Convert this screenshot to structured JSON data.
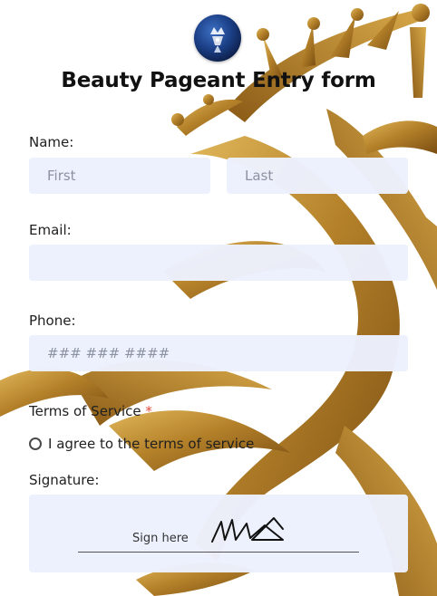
{
  "form": {
    "title": "Beauty Pageant Entry form",
    "name": {
      "label": "Name:",
      "first_placeholder": "First",
      "last_placeholder": "Last"
    },
    "email": {
      "label": "Email:",
      "placeholder": ""
    },
    "phone": {
      "label": "Phone:",
      "placeholder": "### ### ####"
    },
    "terms": {
      "label": "Terms of Service",
      "required_mark": "*",
      "checkbox_text": "I agree to the terms of service",
      "checked": false
    },
    "signature": {
      "label": "Signature:",
      "hint": "Sign here"
    }
  },
  "icons": {
    "logo": "pageant-crown-logo",
    "signature_glyph": "signature-scribble-icon"
  },
  "colors": {
    "gold": "#b8862b",
    "field_background": "#ecf1fe",
    "required": "#e04b3e",
    "logo_blue": "#1b3f86"
  }
}
